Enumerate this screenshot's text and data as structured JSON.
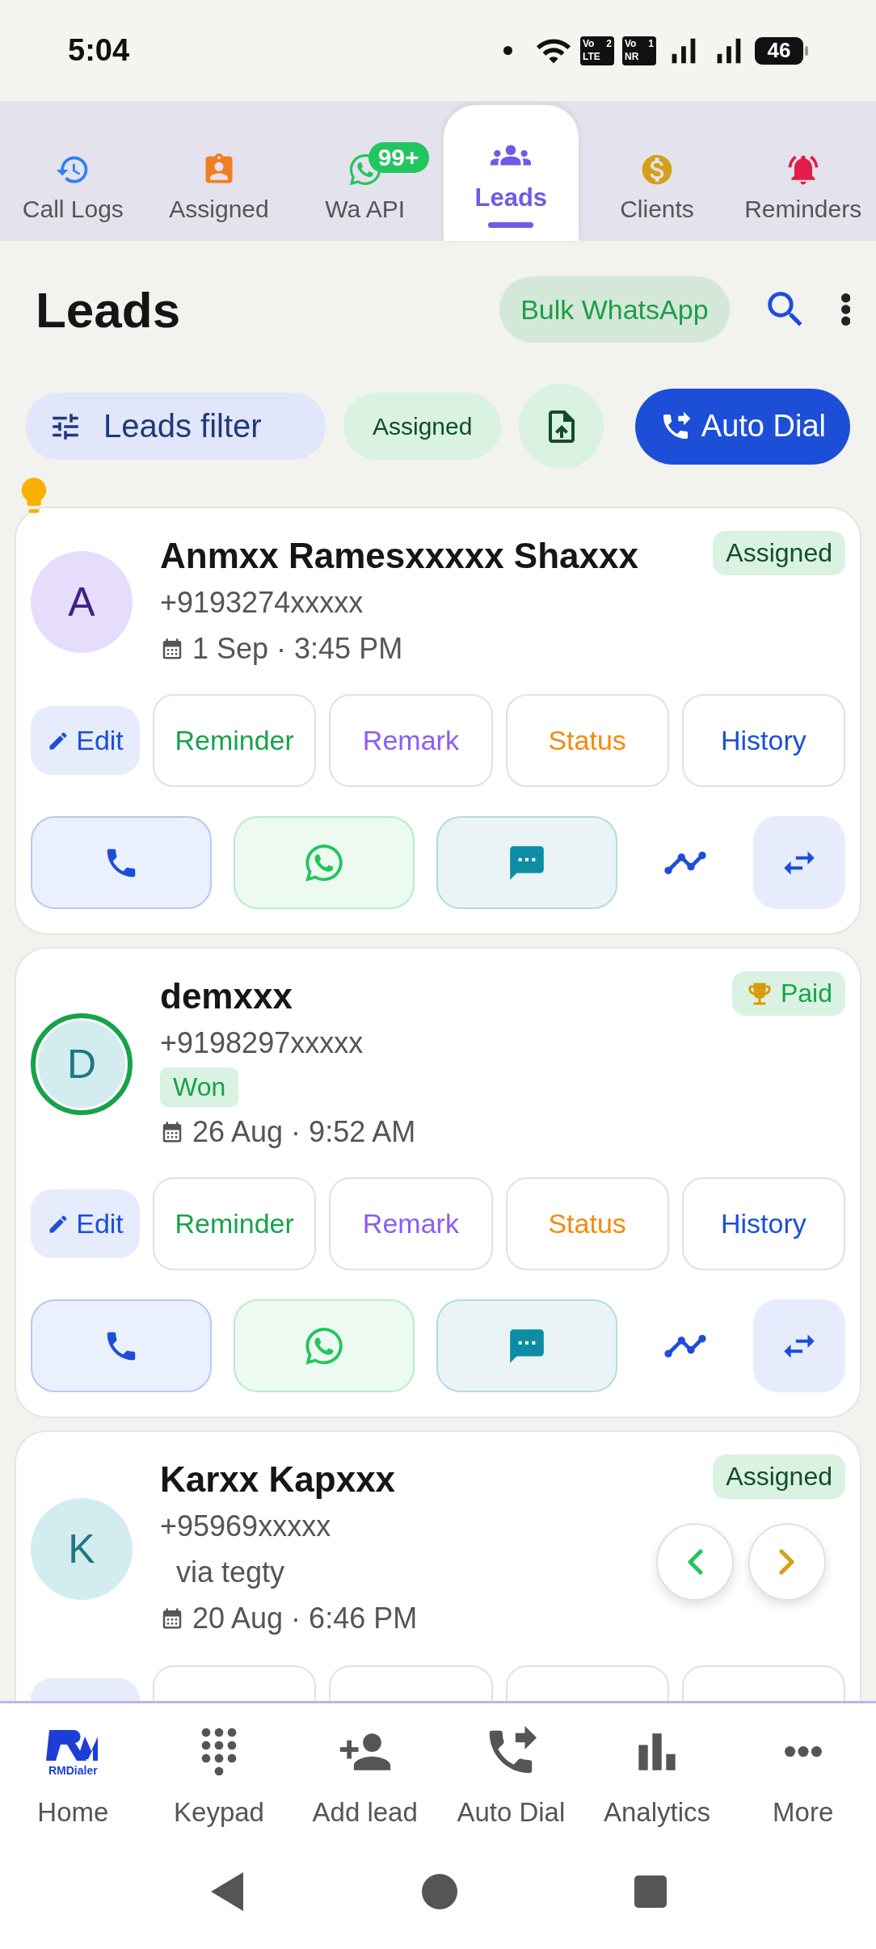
{
  "status_bar": {
    "time": "5:04",
    "network": [
      {
        "top": "Vo",
        "sub": "2",
        "bottom": "LTE"
      },
      {
        "top": "Vo",
        "sub": "1",
        "bottom": "NR"
      }
    ],
    "battery": "46"
  },
  "tabs": [
    {
      "label": "Call Logs",
      "selected": false
    },
    {
      "label": "Assigned",
      "selected": false
    },
    {
      "label": "Wa API",
      "selected": false,
      "badge": "99+"
    },
    {
      "label": "Leads",
      "selected": true
    },
    {
      "label": "Clients",
      "selected": false
    },
    {
      "label": "Reminders",
      "selected": false
    }
  ],
  "header": {
    "title": "Leads",
    "bulk_button": "Bulk WhatsApp"
  },
  "filters": {
    "filter_button": "Leads filter",
    "assigned_chip": "Assigned",
    "auto_dial": "Auto Dial"
  },
  "leads": [
    {
      "name": "Anmxx Ramesxxxxx Shaxxx",
      "phone": "+9193274xxxxx",
      "date": "1 Sep · 3:45 PM",
      "avatar": {
        "letter": "A",
        "color": "#e6dcfb",
        "ringed": false
      },
      "badge": {
        "text": "Assigned",
        "kind": "assigned"
      },
      "actions": [
        {
          "label": "Edit",
          "kind": "edit"
        },
        {
          "label": "Reminder",
          "kind": "reminder"
        },
        {
          "label": "Remark",
          "kind": "remark"
        },
        {
          "label": "Status",
          "kind": "status"
        },
        {
          "label": "History",
          "kind": "history"
        }
      ]
    },
    {
      "name": "demxxx",
      "phone": "+9198297xxxxx",
      "stage": "Won",
      "date": "26 Aug · 9:52 AM",
      "avatar": {
        "letter": "D",
        "color": "#d3ecf0",
        "ringed": true
      },
      "badge": {
        "text": "Paid",
        "kind": "paid"
      },
      "actions": [
        {
          "label": "Edit",
          "kind": "edit"
        },
        {
          "label": "Reminder",
          "kind": "reminder"
        },
        {
          "label": "Remark",
          "kind": "remark"
        },
        {
          "label": "Status",
          "kind": "status"
        },
        {
          "label": "History",
          "kind": "history"
        }
      ]
    },
    {
      "name": "Karxx Kapxxx",
      "phone": "+95969xxxxx",
      "source": "via tegty",
      "date": "20 Aug · 6:46 PM",
      "avatar": {
        "letter": "K",
        "color": "#d3ecf0",
        "ringed": false
      },
      "badge": {
        "text": "Assigned",
        "kind": "assigned"
      },
      "actions_cut": true
    }
  ],
  "bottom_nav": [
    {
      "label": "Home",
      "logo_text": "RMDialer"
    },
    {
      "label": "Keypad"
    },
    {
      "label": "Add lead"
    },
    {
      "label": "Auto Dial"
    },
    {
      "label": "Analytics"
    },
    {
      "label": "More"
    }
  ]
}
